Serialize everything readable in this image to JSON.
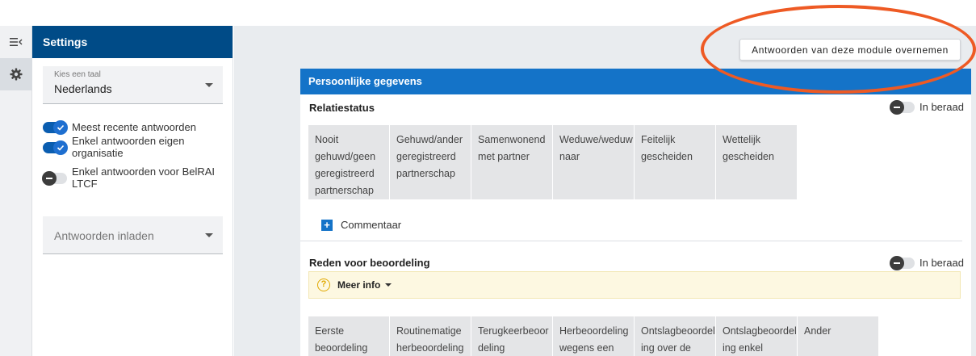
{
  "rail": {
    "collapse_icon": "collapse-menu-icon",
    "settings_icon": "gear-icon"
  },
  "settings": {
    "title": "Settings",
    "language": {
      "label": "Kies een taal",
      "value": "Nederlands"
    },
    "toggles": [
      {
        "label": "Meest recente antwoorden",
        "on": true
      },
      {
        "label": "Enkel antwoorden eigen organisatie",
        "on": true
      },
      {
        "label": "Enkel antwoorden voor BelRAI LTCF",
        "on": false
      }
    ],
    "load_answers": {
      "placeholder": "Antwoorden inladen"
    }
  },
  "main": {
    "take_over_button": "Antwoorden van deze module overnemen",
    "annotation_color": "#ee5a24",
    "module": {
      "title": "Persoonlijke gegevens",
      "sections": [
        {
          "title": "Relatiestatus",
          "in_beraad": "In beraad",
          "options": [
            "Nooit gehuwd/geen geregistreerd partnerschap",
            "Gehuwd/ander geregistreerd partnerschap",
            "Samenwonend met partner",
            "Weduwe/weduwnaar",
            "Feitelijk gescheiden",
            "Wettelijk gescheiden"
          ],
          "comment_label": "Commentaar"
        },
        {
          "title": "Reden voor beoordeling",
          "in_beraad": "In beraad",
          "more_info": "Meer info",
          "options": [
            "Eerste beoordeling",
            "Routinematige herbeoordeling",
            "Terugkeerbeoordeling",
            "Herbeoordeling wegens een",
            "Ontslagbeoordeling over de",
            "Ontslagbeoordeling enkel",
            "Ander"
          ]
        }
      ]
    }
  },
  "colors": {
    "header_dark_blue": "#004b87",
    "module_blue": "#1473c8",
    "toggle_on": "#1e6fd0"
  }
}
